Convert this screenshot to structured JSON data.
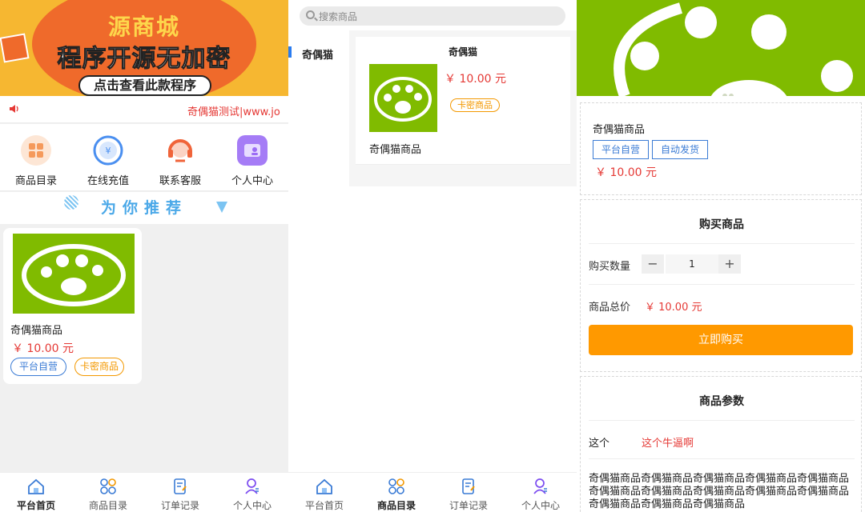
{
  "home": {
    "banner": {
      "line1": "源商城",
      "line2": "程序开源无加密",
      "button": "点击查看此款程序"
    },
    "notice": {
      "icon": "speaker-icon",
      "text": "奇偶猫测试|www.jo"
    },
    "quick_nav": [
      {
        "label": "商品目录",
        "icon": "grid-icon",
        "color": "#f59a5c"
      },
      {
        "label": "在线充值",
        "icon": "yen-icon",
        "color": "#4a8ff0"
      },
      {
        "label": "联系客服",
        "icon": "headset-icon",
        "color": "#f0643a"
      },
      {
        "label": "个人中心",
        "icon": "user-card-icon",
        "color": "#9b6cf5"
      }
    ],
    "recommend_title": "为你推荐",
    "product": {
      "name": "奇偶猫商品",
      "price": "￥ 10.00 元",
      "tags": [
        "平台自营",
        "卡密商品"
      ]
    }
  },
  "catalog": {
    "search_placeholder": "搜索商品",
    "categories": [
      "奇偶猫"
    ],
    "section_title": "奇偶猫",
    "product": {
      "name": "奇偶猫商品",
      "price": "￥ 10.00 元",
      "tag": "卡密商品"
    }
  },
  "detail": {
    "product_name": "奇偶猫商品",
    "tags": [
      "平台自营",
      "自动发货"
    ],
    "price": "￥ 10.00 元",
    "buy_section_title": "购买商品",
    "qty_label": "购买数量",
    "qty_value": "1",
    "total_label": "商品总价",
    "total_value": "￥ 10.00 元",
    "buy_button": "立即购买",
    "params_title": "商品参数",
    "params": [
      {
        "key": "这个",
        "value": "这个牛逼啊"
      }
    ],
    "description": "奇偶猫商品奇偶猫商品奇偶猫商品奇偶猫商品奇偶猫商品奇偶猫商品奇偶猫商品奇偶猫商品奇偶猫商品奇偶猫商品奇偶猫商品奇偶猫商品奇偶猫商品"
  },
  "tabbar": {
    "items": [
      "平台首页",
      "商品目录",
      "订单记录",
      "个人中心"
    ],
    "icons": [
      "home-icon",
      "grid-icon",
      "order-icon",
      "user-icon"
    ]
  },
  "colors": {
    "accent_blue": "#3a7bd5",
    "price_red": "#e53935",
    "buy_orange": "#ff9900",
    "product_green": "#80bb00"
  }
}
